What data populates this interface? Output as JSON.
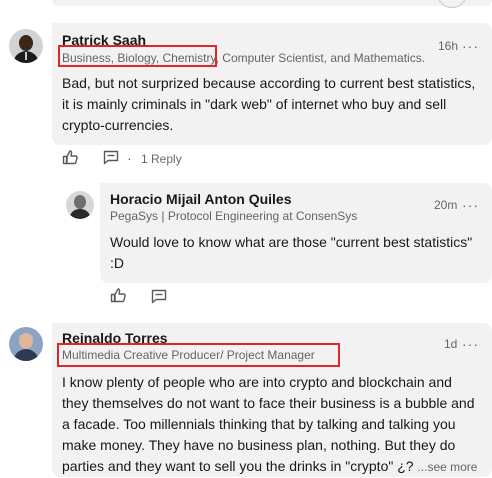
{
  "comments": [
    {
      "author": "Patrick Saah",
      "headline_highlighted": "Business, Biology, Chemistry,",
      "headline_rest": " Computer Scientist, and Mathematics.",
      "time": "16h",
      "more": "···",
      "body": "Bad, but not surprized because according to current best statistics, it is mainly criminals in \"dark web\" of internet who buy and sell crypto-currencies.",
      "replies_sep": "·",
      "replies_label": "1 Reply"
    },
    {
      "author": "Horacio Mijail Anton Quiles",
      "headline": "PegaSys | Protocol Engineering at ConsenSys",
      "time": "20m",
      "more": "···",
      "body": "Would love to know what are those \"current best statistics\" :D"
    },
    {
      "author": "Reinaldo Torres",
      "headline": "Multimedia Creative Producer/ Project Manager",
      "time": "1d",
      "more": "···",
      "body": "I know plenty of people who are into crypto and blockchain and they themselves do not want to face their business is a bubble and a facade. Too millennials thinking that by talking and talking you make money. They have no business plan, nothing. But they do parties and they want to sell you the drinks in \"crypto\" ¿?",
      "see_more": "...see more"
    }
  ],
  "icons": [
    "like-icon",
    "comment-icon"
  ],
  "colors": {
    "bubble": "#f2f2f2",
    "highlight": "#e0262a"
  }
}
